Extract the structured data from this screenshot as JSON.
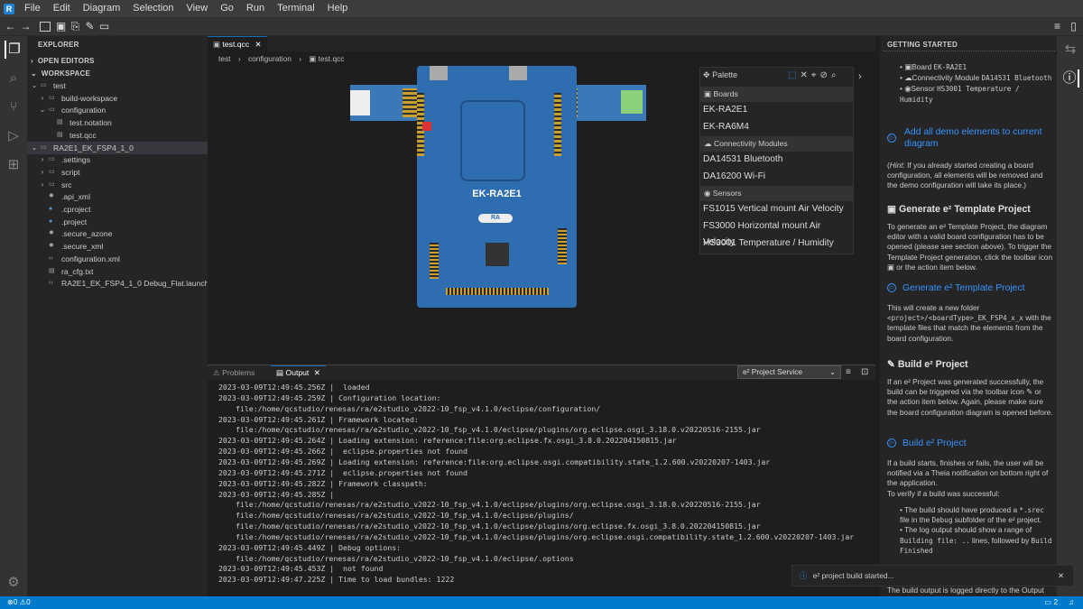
{
  "app": {
    "logo": "R"
  },
  "menu": [
    "File",
    "Edit",
    "Diagram",
    "Selection",
    "View",
    "Go",
    "Run",
    "Terminal",
    "Help"
  ],
  "sidebar": {
    "title": "EXPLORER",
    "open_editors": "OPEN EDITORS",
    "workspace": "WORKSPACE",
    "tree": [
      {
        "label": "test",
        "depth": 0,
        "kind": "folder-open"
      },
      {
        "label": "build-workspace",
        "depth": 1,
        "kind": "folder"
      },
      {
        "label": "configuration",
        "depth": 1,
        "kind": "folder-open"
      },
      {
        "label": "test.notation",
        "depth": 2,
        "kind": "file"
      },
      {
        "label": "test.qcc",
        "depth": 2,
        "kind": "file"
      },
      {
        "label": "RA2E1_EK_FSP4_1_0",
        "depth": 0,
        "kind": "folder-open"
      },
      {
        "label": ".settings",
        "depth": 1,
        "kind": "folder"
      },
      {
        "label": "script",
        "depth": 1,
        "kind": "folder"
      },
      {
        "label": "src",
        "depth": 1,
        "kind": "folder"
      },
      {
        "label": ".api_xml",
        "depth": 1,
        "kind": "gear"
      },
      {
        "label": ".cproject",
        "depth": 1,
        "kind": "globe"
      },
      {
        "label": ".project",
        "depth": 1,
        "kind": "globe"
      },
      {
        "label": ".secure_azone",
        "depth": 1,
        "kind": "gear"
      },
      {
        "label": ".secure_xml",
        "depth": 1,
        "kind": "gear"
      },
      {
        "label": "configuration.xml",
        "depth": 1,
        "kind": "code"
      },
      {
        "label": "ra_cfg.txt",
        "depth": 1,
        "kind": "file"
      },
      {
        "label": "RA2E1_EK_FSP4_1_0 Debug_Flat.launch",
        "depth": 1,
        "kind": "code"
      }
    ]
  },
  "editor": {
    "tab": "test.qcc",
    "breadcrumb": [
      "test",
      "configuration",
      "test.qcc"
    ],
    "board_label": "EK-RA2E1"
  },
  "palette": {
    "title": "Palette",
    "groups": [
      {
        "header": "Boards",
        "items": [
          "EK-RA2E1",
          "EK-RA6M4"
        ]
      },
      {
        "header": "Connectivity Modules",
        "items": [
          "DA14531 Bluetooth",
          "DA16200 Wi-Fi"
        ]
      },
      {
        "header": "Sensors",
        "items": [
          "FS1015 Vertical mount Air Velocity",
          "FS3000 Horizontal mount Air Velocity",
          "HS3001 Temperature / Humidity"
        ]
      }
    ]
  },
  "panel": {
    "tabs": [
      "Problems",
      "Output"
    ],
    "active": "Output",
    "channel": "e² Project Service",
    "lines": [
      {
        "t": "2023-03-09T12:49:45.256Z |  loaded",
        "i": false
      },
      {
        "t": "2023-03-09T12:49:45.259Z | Configuration location:",
        "i": false
      },
      {
        "t": "file:/home/qcstudio/renesas/ra/e2studio_v2022-10_fsp_v4.1.0/eclipse/configuration/",
        "i": true
      },
      {
        "t": "2023-03-09T12:49:45.261Z | Framework located:",
        "i": false
      },
      {
        "t": "file:/home/qcstudio/renesas/ra/e2studio_v2022-10_fsp_v4.1.0/eclipse/plugins/org.eclipse.osgi_3.18.0.v20220516-2155.jar",
        "i": true
      },
      {
        "t": "2023-03-09T12:49:45.264Z | Loading extension: reference:file:org.eclipse.fx.osgi_3.8.0.202204150815.jar",
        "i": false
      },
      {
        "t": "2023-03-09T12:49:45.266Z |  eclipse.properties not found",
        "i": false
      },
      {
        "t": "2023-03-09T12:49:45.269Z | Loading extension: reference:file:org.eclipse.osgi.compatibility.state_1.2.600.v20220207-1403.jar",
        "i": false
      },
      {
        "t": "2023-03-09T12:49:45.271Z |  eclipse.properties not found",
        "i": false
      },
      {
        "t": "2023-03-09T12:49:45.282Z | Framework classpath:",
        "i": false
      },
      {
        "t": "2023-03-09T12:49:45.285Z |",
        "i": false
      },
      {
        "t": "file:/home/qcstudio/renesas/ra/e2studio_v2022-10_fsp_v4.1.0/eclipse/plugins/org.eclipse.osgi_3.18.0.v20220516-2155.jar",
        "i": true
      },
      {
        "t": "file:/home/qcstudio/renesas/ra/e2studio_v2022-10_fsp_v4.1.0/eclipse/plugins/",
        "i": true
      },
      {
        "t": "file:/home/qcstudio/renesas/ra/e2studio_v2022-10_fsp_v4.1.0/eclipse/plugins/org.eclipse.fx.osgi_3.8.0.202204150815.jar",
        "i": true
      },
      {
        "t": "file:/home/qcstudio/renesas/ra/e2studio_v2022-10_fsp_v4.1.0/eclipse/plugins/org.eclipse.osgi.compatibility.state_1.2.600.v20220207-1403.jar",
        "i": true
      },
      {
        "t": "2023-03-09T12:49:45.449Z | Debug options:",
        "i": false
      },
      {
        "t": "file:/home/qcstudio/renesas/ra/e2studio_v2022-10_fsp_v4.1.0/eclipse/.options",
        "i": true
      },
      {
        "t": "2023-03-09T12:49:45.453Z |  not found",
        "i": false
      },
      {
        "t": "2023-03-09T12:49:47.225Z | Time to load bundles: 1222",
        "i": false
      }
    ]
  },
  "getting_started": {
    "title": "GETTING STARTED",
    "list1": [
      {
        "label": "Board",
        "value": "EK-RA2E1"
      },
      {
        "label": "Connectivity Module",
        "value": "DA14531 Bluetooth"
      },
      {
        "label": "Sensor",
        "value": "HS3001 Temperature / Humidity"
      }
    ],
    "link_add": "Add all demo elements to current diagram",
    "hint_prefix": "Hint",
    "hint": ": If you already started creating a board configuration, all elements will be removed and the demo configuration will take its place.)",
    "h_template": "Generate e² Template Project",
    "p_template": "To generate an e² Template Project, the diagram editor with a valid board configuration has to be opened (please see section above). To trigger the Template Project generation, click the toolbar icon",
    "p_template_end": "or the action item below.",
    "link_template": "Generate e² Template Project",
    "p_folder_a": "This will create a new folder",
    "p_folder_code": "<project>/<boardType>_EK_FSP4_x_x",
    "p_folder_b": "with the template files that match the elements from the board configuration.",
    "h_build": "Build e² Project",
    "p_build": "If an e² Project was generated successfully, the build can be triggered via the toolbar icon",
    "p_build_end": "or the action item below. Again, please make sure the board configuration diagram is opened before.",
    "link_build": "Build e² Project",
    "p_notify": "If a build starts, finishes or fails, the user will be notified via a Theia notification on bottom right of the application.",
    "p_verify": "To verify if a build was successful:",
    "bullet1_a": "The build should have produced a",
    "bullet1_code": "*.srec",
    "bullet1_b": "file in the",
    "bullet1_code2": "Debug",
    "bullet1_c": "subfolder of the e² project.",
    "bullet2_a": "The log output should show a range of",
    "bullet2_code": "Building file: ..",
    "bullet2_b": "lines, followed by",
    "bullet2_code2": "Build Finished",
    "p_tail": "The build output is logged directly to the Output"
  },
  "notification": {
    "text": "e² project build started..."
  },
  "status": {
    "errors": "0",
    "warnings": "0",
    "right_count": "2"
  },
  "colors": {
    "accent": "#007acc",
    "link": "#3794ff",
    "board": "#2f6db1"
  }
}
